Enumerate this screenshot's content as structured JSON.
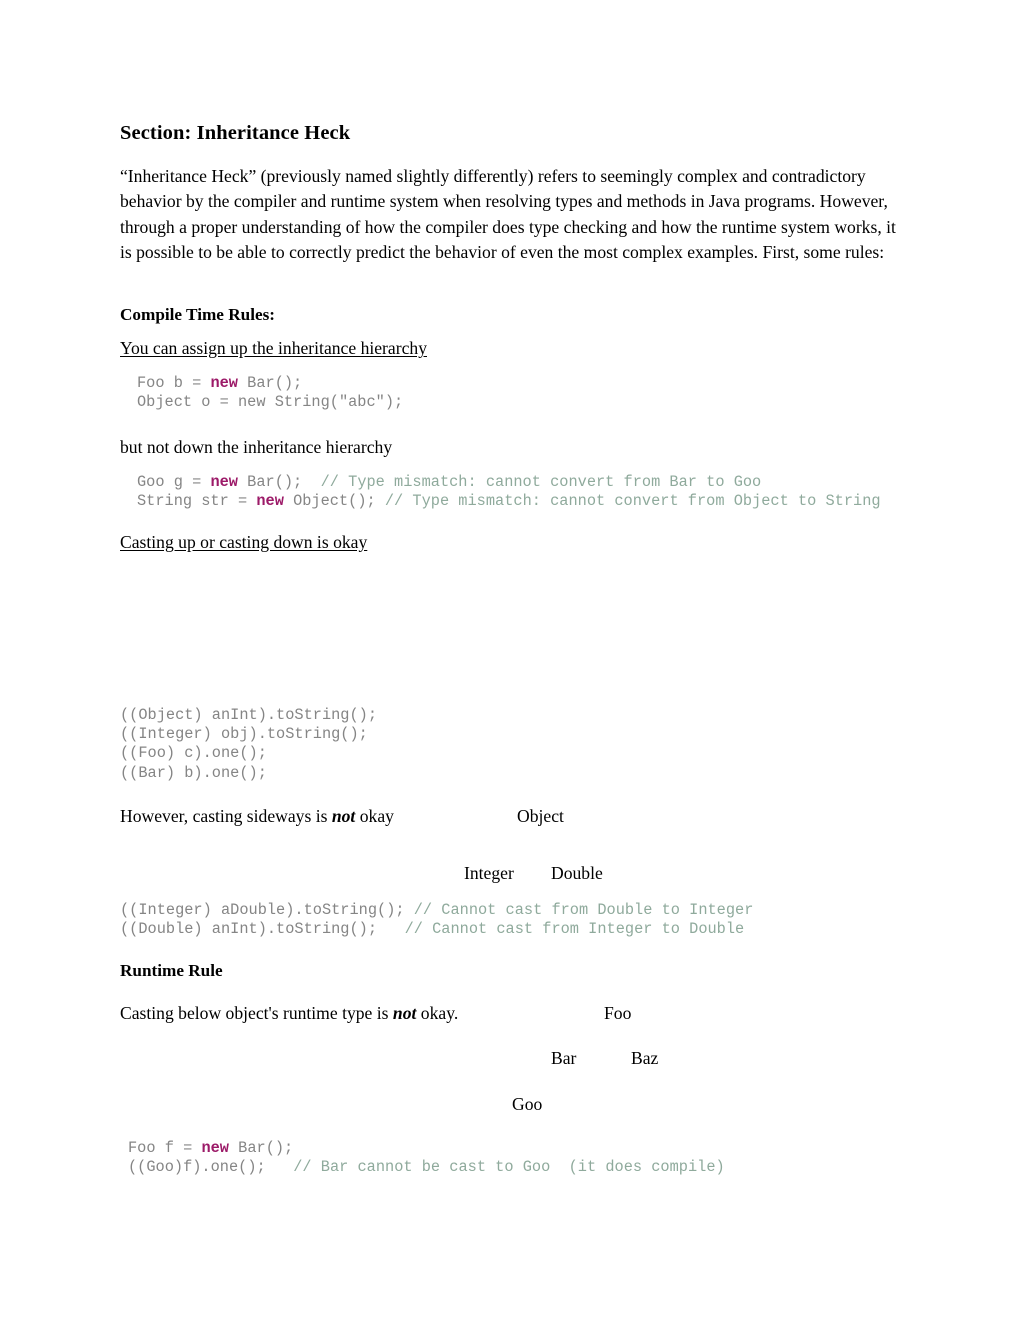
{
  "document": {
    "title": "Section: Inheritance Heck",
    "intro_paragraph": "“Inheritance Heck” (previously named slightly differently) refers to seemingly complex and contradictory behavior by the compiler and runtime system when resolving types and methods in Java programs. However, through a proper understanding of how the compiler does type checking and how the runtime system works, it is possible to be able to correctly predict the behavior of even the most complex examples. First, some rules:"
  },
  "compile_time": {
    "heading": "Compile Time Rules:",
    "rule_up": "You can assign up the inheritance hierarchy ",
    "code_up": {
      "line1_a": "Foo b = ",
      "line1_kw": "new",
      "line1_b": " Bar();",
      "line2": "Object o = new String(\"abc\");"
    },
    "rule_down": "but not down the inheritance hierarchy",
    "code_down": {
      "line1_a": "Goo g = ",
      "line1_kw": "new",
      "line1_b": " Bar();  ",
      "line1_cmt": "// Type mismatch: cannot convert from Bar to Goo",
      "line2_a": "String str = ",
      "line2_kw": "new",
      "line2_b": " Object(); ",
      "line2_cmt": "// Type mismatch: cannot convert from Object to String"
    },
    "rule_cast": "Casting up or casting down is okay",
    "code_cast": {
      "line1": "((Object) anInt).toString();",
      "line2": "((Integer) obj).toString();",
      "line3": "((Foo) c).one();",
      "line4": "((Bar) b).one();"
    },
    "rule_sideways_a": "However, casting sideways is ",
    "rule_sideways_em": "not",
    "rule_sideways_b": " okay",
    "code_sideways": {
      "line1_a": "((Integer) aDouble).toString(); ",
      "line1_cmt": "// Cannot cast from Double to Integer",
      "line2_a": "((Double) anInt).toString();   ",
      "line2_cmt": "// Cannot cast from Integer to Double"
    }
  },
  "runtime": {
    "heading": "Runtime Rule",
    "rule_a": "Casting below object's runtime type is ",
    "rule_em": "not",
    "rule_b": " okay.",
    "code_runtime": {
      "line1_a": "Foo f = ",
      "line1_kw": "new",
      "line1_b": " Bar();",
      "line2_a": "((Goo)f).one();   ",
      "line2_cmt": "// Bar cannot be cast to Goo  (it does compile)"
    }
  },
  "diagram_sideways": {
    "root": "Object",
    "child_left": "Integer",
    "child_right": "Double"
  },
  "diagram_runtime": {
    "root": "Foo",
    "child_left": "Bar",
    "child_right": "Baz",
    "grandchild": "Goo"
  },
  "colors": {
    "keyword": "#9c1a68",
    "comment": "#8faa9c",
    "code_text": "#858585",
    "body_text": "#000000",
    "page_background": "#ffffff"
  }
}
